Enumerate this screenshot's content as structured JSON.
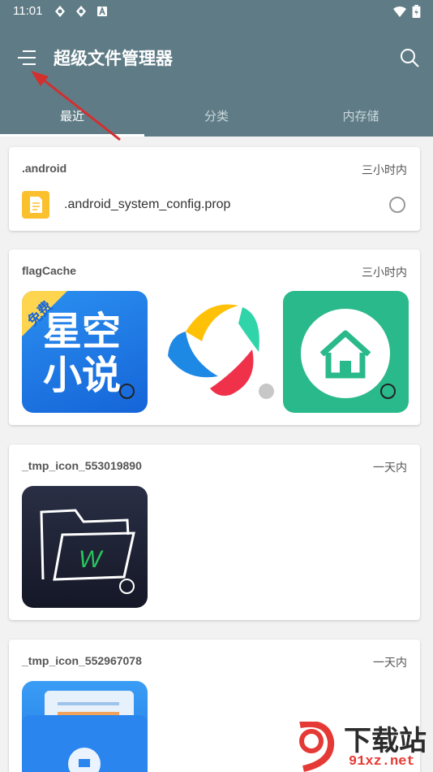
{
  "status_bar": {
    "time": "11:01",
    "icons": [
      "sync-icon",
      "sync-icon",
      "notification-a-icon",
      "wifi-icon",
      "battery-icon"
    ]
  },
  "app_bar": {
    "title": "超级文件管理器",
    "menu_icon": "menu-icon",
    "search_icon": "search-icon",
    "color": "#5f7c86"
  },
  "tabs": [
    {
      "label": "最近",
      "active": true
    },
    {
      "label": "分类",
      "active": false
    },
    {
      "label": "内存储",
      "active": false
    }
  ],
  "groups": [
    {
      "folder": ".android",
      "time": "三小时内",
      "files": [
        {
          "name": ".android_system_config.prop",
          "icon": "text-file-icon"
        }
      ]
    },
    {
      "folder": "flagCache",
      "time": "三小时内",
      "thumbs": [
        {
          "name": "star-novel-app-icon",
          "badge": "免费",
          "line1": "星空",
          "line2": "小说"
        },
        {
          "name": "tencent-app-store-icon"
        },
        {
          "name": "home-app-icon"
        }
      ]
    },
    {
      "folder": "_tmp_icon_553019890",
      "time": "一天内",
      "thumbs": [
        {
          "name": "file-manager-w-app-icon",
          "letter": "W"
        }
      ]
    },
    {
      "folder": "_tmp_icon_552967078",
      "time": "一天内",
      "thumbs": [
        {
          "name": "secure-folder-app-icon"
        }
      ]
    }
  ],
  "watermark": {
    "logo_text": "下载站",
    "url_text": "91xz.net"
  }
}
